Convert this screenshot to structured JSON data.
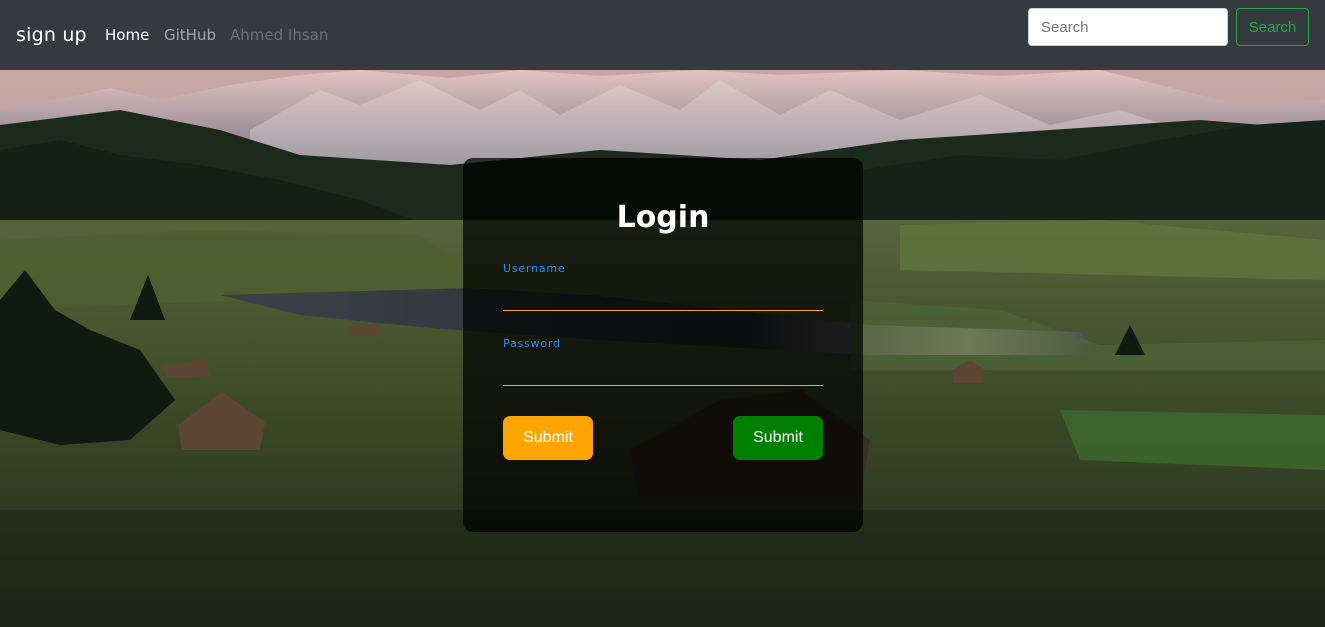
{
  "navbar": {
    "brand": "sign up",
    "links": [
      {
        "label": "Home"
      },
      {
        "label": "GitHub"
      },
      {
        "label": "Ahmed Ihsan"
      }
    ],
    "search_placeholder": "Search",
    "search_button": "Search"
  },
  "login": {
    "title": "Login",
    "username_label": "Username",
    "password_label": "Password",
    "submit_primary": "Submit",
    "submit_secondary": "Submit"
  },
  "colors": {
    "navbar_bg": "#343a40",
    "label_blue": "#1e90ff",
    "underline_orange": "#f4a623",
    "button_orange": "#ffa500",
    "button_green": "#008000",
    "search_green": "#28a745"
  }
}
